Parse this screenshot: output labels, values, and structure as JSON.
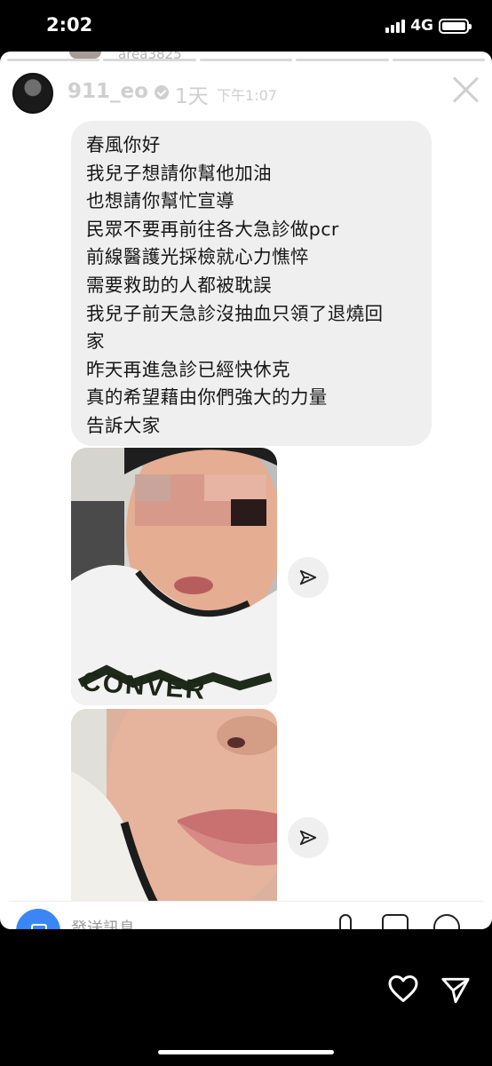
{
  "status_bar": {
    "time": "2:02",
    "network": "4G",
    "battery_level": 1.0
  },
  "story": {
    "progress_segments": 5,
    "peek_username": "area3825",
    "username": "911_eo",
    "verified": true,
    "age": "1天",
    "time": "下午1:07"
  },
  "message": {
    "lines": [
      "春風你好",
      "我兒子想請你幫他加油",
      "也想請你幫忙宣導",
      "民眾不要再前往各大急診做pcr",
      "前線醫護光採檢就心力憔悴",
      "需要救助的人都被耽誤",
      "我兒子前天急診沒抽血只領了退燒回",
      "家",
      "昨天再進急診已經快休克",
      "真的希望藉由你們強大的力量",
      "告訴大家"
    ]
  },
  "photos": [
    {
      "overlay_text": "CONVER"
    },
    {
      "overlay_text": ""
    }
  ],
  "composer": {
    "placeholder": "發送訊息"
  },
  "icons": {
    "close": "close-icon",
    "share": "send-arrow-icon",
    "camera": "camera-icon",
    "mic": "mic-icon",
    "gallery": "gallery-icon",
    "sticker": "sticker-icon",
    "like": "heart-icon",
    "send": "send-icon"
  },
  "colors": {
    "bubble": "#efefef",
    "camera": "#3a86f5",
    "background": "#000000"
  }
}
